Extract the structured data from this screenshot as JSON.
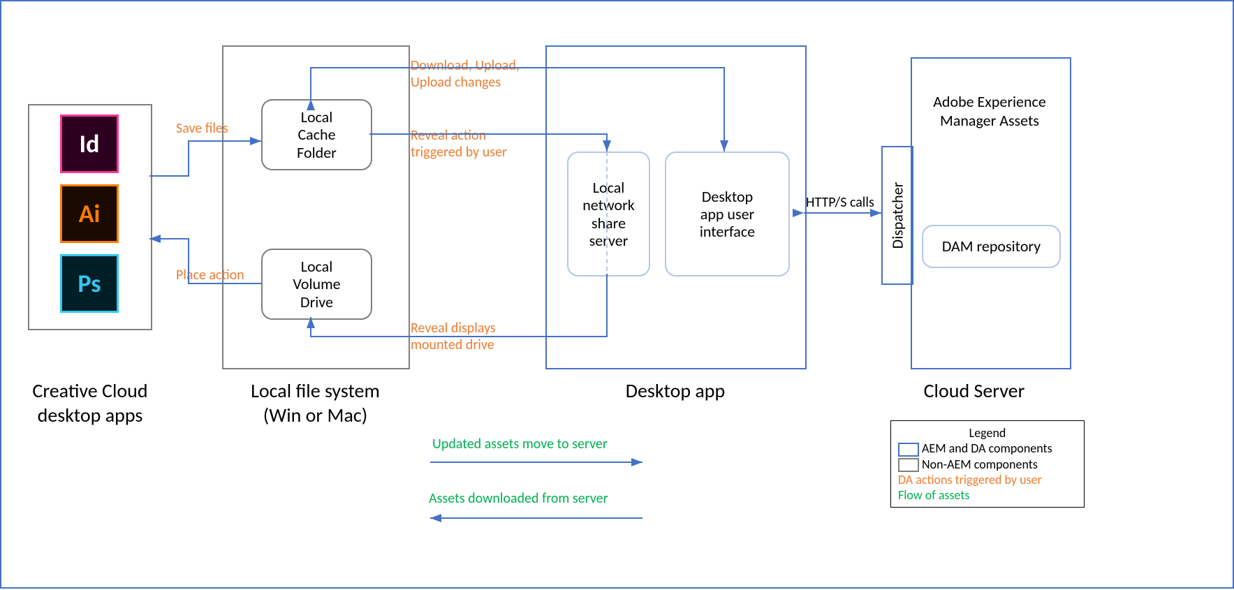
{
  "groups": {
    "cc": "Creative Cloud\ndesktop apps",
    "fs": "Local file system\n(Win or Mac)",
    "da": "Desktop app",
    "cs": "Cloud Server"
  },
  "nodes": {
    "id_app": "Id",
    "ai_app": "Ai",
    "ps_app": "Ps",
    "cache": "Local\nCache\nFolder",
    "volume": "Local\nVolume\nDrive",
    "share": "Local\nnetwork\nshare\nserver",
    "ui": "Desktop\napp user\ninterface",
    "dispatcher": "Dispatcher",
    "aem_title": "Adobe Experience\nManager Assets",
    "dam": "DAM repository"
  },
  "labels": {
    "save": "Save files",
    "place": "Place action",
    "download_upload": "Download, Upload,\nUpload changes",
    "reveal_user": "Reveal action\ntriggered by user",
    "reveal_mount": "Reveal displays\nmounted drive",
    "http": "HTTP/S calls",
    "updated": "Updated assets move to server",
    "downloaded": "Assets downloaded from server"
  },
  "legend": {
    "title": "Legend",
    "aem": "AEM and DA components",
    "nonaem": "Non-AEM components",
    "da_actions": "DA actions triggered by user",
    "flow": "Flow of assets"
  }
}
